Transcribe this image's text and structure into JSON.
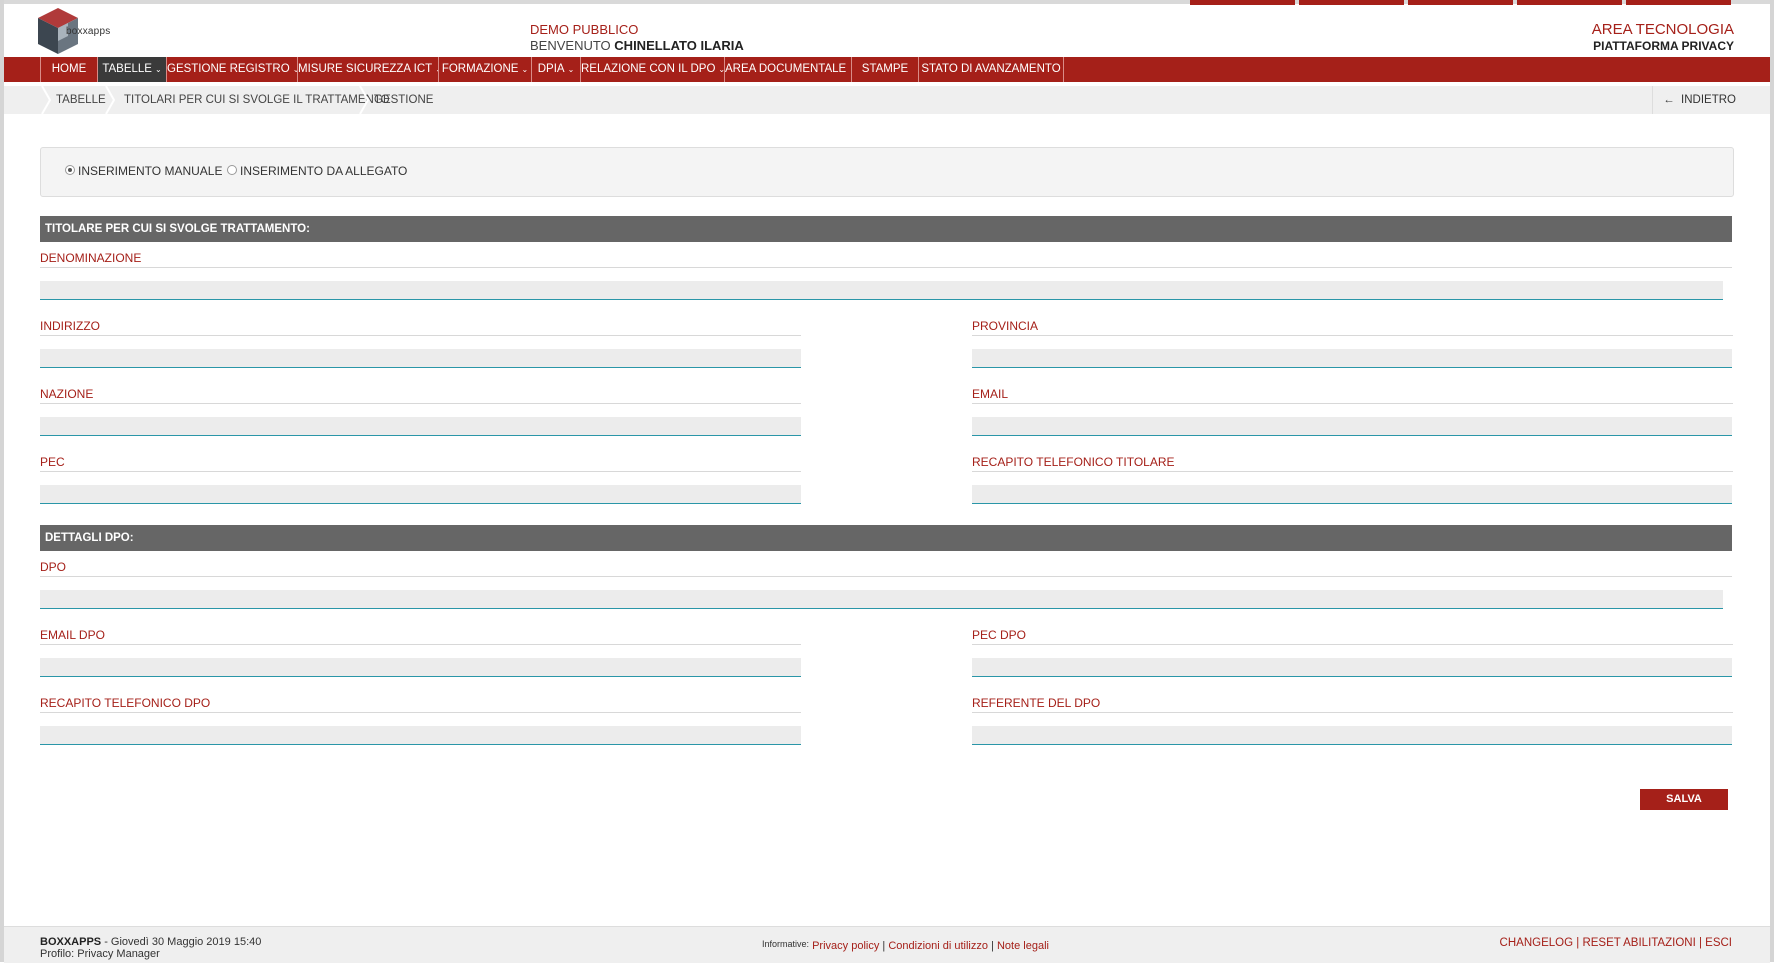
{
  "header": {
    "logo_text": "boxxapps",
    "center_line1": "DEMO PUBBLICO",
    "center_line2_prefix": "BENVENUTO",
    "center_line2_user": "CHINELLATO ILARIA",
    "right_line1": "AREA TECNOLOGIA",
    "right_line2": "PIATTAFORMA PRIVACY"
  },
  "nav": {
    "items": [
      {
        "label": "HOME",
        "dropdown": false
      },
      {
        "label": "TABELLE",
        "dropdown": true,
        "active": true
      },
      {
        "label": "GESTIONE REGISTRO",
        "dropdown": true
      },
      {
        "label": "MISURE SICUREZZA ICT",
        "dropdown": true
      },
      {
        "label": "FORMAZIONE",
        "dropdown": true
      },
      {
        "label": "DPIA",
        "dropdown": true
      },
      {
        "label": "RELAZIONE CON IL DPO",
        "dropdown": true
      },
      {
        "label": "AREA DOCUMENTALE",
        "dropdown": true
      },
      {
        "label": "STAMPE",
        "dropdown": false
      },
      {
        "label": "STATO DI AVANZAMENTO",
        "dropdown": false
      }
    ]
  },
  "breadcrumb": {
    "items": [
      "TABELLE",
      "TITOLARI PER CUI SI SVOLGE IL TRATTAMENTO",
      "GESTIONE"
    ],
    "back_label": "INDIETRO"
  },
  "mode": {
    "option_manual": "INSERIMENTO MANUALE",
    "option_attachment": "INSERIMENTO DA ALLEGATO",
    "selected": "manual"
  },
  "form": {
    "section1_title": "TITOLARE PER CUI SI SVOLGE TRATTAMENTO:",
    "denominazione": "DENOMINAZIONE",
    "indirizzo": "INDIRIZZO",
    "provincia": "PROVINCIA",
    "nazione": "NAZIONE",
    "email": "EMAIL",
    "pec": "PEC",
    "recapito_titolare": "RECAPITO TELEFONICO TITOLARE",
    "section2_title": "DETTAGLI DPO:",
    "dpo": "DPO",
    "email_dpo": "EMAIL DPO",
    "pec_dpo": "PEC DPO",
    "recapito_dpo": "RECAPITO TELEFONICO DPO",
    "referente_dpo": "REFERENTE DEL DPO",
    "save_label": "SALVA"
  },
  "footer": {
    "brand": "BOXXAPPS",
    "datetime": " - Giovedì 30 Maggio 2019 15:40",
    "profile": "Profilo: Privacy Manager",
    "info_label": "Informative:",
    "privacy": "Privacy policy",
    "conditions": "Condizioni di utilizzo",
    "legal": "Note legali",
    "changelog": "CHANGELOG",
    "reset": "RESET ABILITAZIONI",
    "exit": "ESCI"
  },
  "colors": {
    "brand_red": "#a52019",
    "section_gray": "#666666",
    "input_underline": "#2a96a8"
  }
}
